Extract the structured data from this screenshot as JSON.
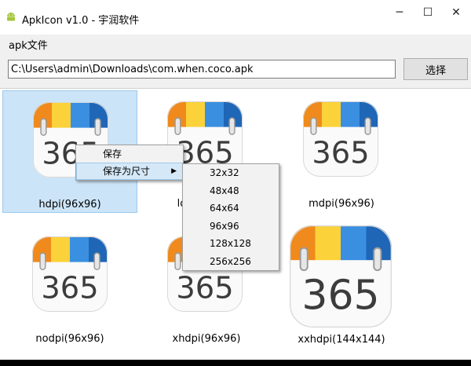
{
  "window": {
    "title": "ApkIcon v1.0 - 宇润软件",
    "minimize": "─",
    "maximize": "☐",
    "close": "✕"
  },
  "apk": {
    "label": "apk文件",
    "path": "C:\\Users\\admin\\Downloads\\com.when.coco.apk",
    "choose_label": "选择"
  },
  "icons": [
    {
      "label": "hdpi(96x96)",
      "number": "365"
    },
    {
      "label": "ldpi(36x36)",
      "number": "365"
    },
    {
      "label": "mdpi(96x96)",
      "number": "365"
    },
    {
      "label": "nodpi(96x96)",
      "number": "365"
    },
    {
      "label": "xhdpi(96x96)",
      "number": "365"
    },
    {
      "label": "xxhdpi(144x144)",
      "number": "365"
    }
  ],
  "context_menu": {
    "save": "保存",
    "save_as_size": "保存为尺寸",
    "arrow": "▶",
    "sizes": [
      "32x32",
      "48x48",
      "64x64",
      "96x96",
      "128x128",
      "256x256"
    ]
  },
  "colors": {
    "orange": "#f08a1c",
    "yellow": "#fbd23a",
    "blue": "#3a8fe0",
    "darkblue": "#1f66b6",
    "number": "#3c3c3c"
  }
}
